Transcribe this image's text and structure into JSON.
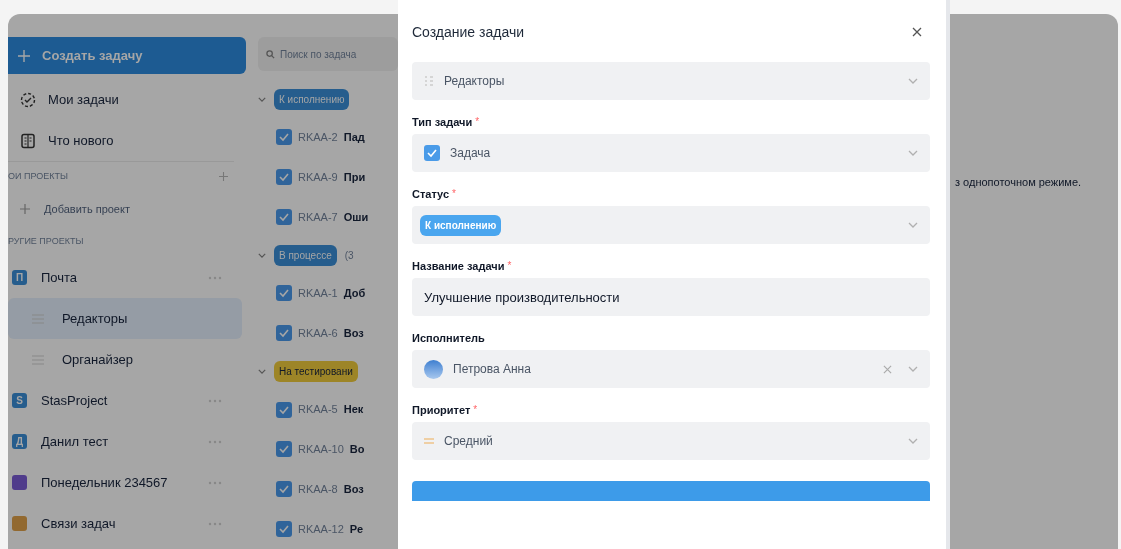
{
  "sidebar": {
    "create_button": "Создать задачу",
    "nav": [
      {
        "label": "Мои задачи"
      },
      {
        "label": "Что нового"
      }
    ],
    "my_projects": {
      "heading": "ОИ ПРОЕКТЫ",
      "add_label": "Добавить проект"
    },
    "other_projects": {
      "heading": "РУГИЕ ПРОЕКТЫ",
      "projects": [
        {
          "name": "Почта",
          "initial": "П",
          "color": "#265d8d",
          "children": [
            {
              "name": "Редакторы",
              "selected": true
            },
            {
              "name": "Органайзер",
              "selected": false
            }
          ]
        },
        {
          "name": "StasProject",
          "initial": "S",
          "color": "#265d8d"
        },
        {
          "name": "Данил тест",
          "initial": "Д",
          "color": "#265d8d"
        },
        {
          "name": "Понедельник 234567",
          "color": "#503c8b"
        },
        {
          "name": "Связи задач",
          "color": "#926930"
        }
      ]
    }
  },
  "task_list": {
    "search_placeholder": "Поиск по задача",
    "groups": [
      {
        "status": "К исполнению",
        "color": "#265d8d",
        "expanded": true,
        "tasks": [
          {
            "key": "RKAA-2",
            "title": "Пад",
            "checked": true
          },
          {
            "key": "RKAA-9",
            "title": "При",
            "checked": true
          },
          {
            "key": "RKAA-7",
            "title": "Оши",
            "checked": true
          }
        ]
      },
      {
        "status": "В процессе",
        "count": "(3",
        "color": "#265d8d",
        "expanded": true,
        "tasks": [
          {
            "key": "RKAA-1",
            "title": "Доб",
            "checked": true
          },
          {
            "key": "RKAA-6",
            "title": "Воз",
            "checked": true
          }
        ]
      },
      {
        "status": "На тестировани",
        "color": "#9d8527",
        "expanded": true,
        "tasks": [
          {
            "key": "RKAA-5",
            "title": "Нек",
            "checked": true
          },
          {
            "key": "RKAA-10",
            "title": "Во",
            "checked": true
          },
          {
            "key": "RKAA-8",
            "title": "Воз",
            "checked": true
          },
          {
            "key": "RKAA-12",
            "title": "Ре",
            "checked": true
          }
        ]
      }
    ]
  },
  "detail": {
    "text": "з однопоточном режиме."
  },
  "modal": {
    "title": "Создание задачи",
    "fields": [
      {
        "kind": "project",
        "value": "Редакторы"
      },
      {
        "kind": "type",
        "label": "Тип задачи",
        "required_mark": "*",
        "value": "Задача"
      },
      {
        "kind": "status",
        "label": "Статус",
        "required_mark": "*",
        "color": "#4aa6ef",
        "value": "К исполнению"
      },
      {
        "kind": "input",
        "label": "Название задачи",
        "required_mark": "*",
        "value": "Улучшение производительности"
      },
      {
        "kind": "user",
        "label": "Исполнитель",
        "value": "Петрова Анна",
        "clearable": true
      },
      {
        "kind": "priority",
        "label": "Приоритет",
        "required_mark": "*",
        "value": "Средний"
      }
    ]
  }
}
